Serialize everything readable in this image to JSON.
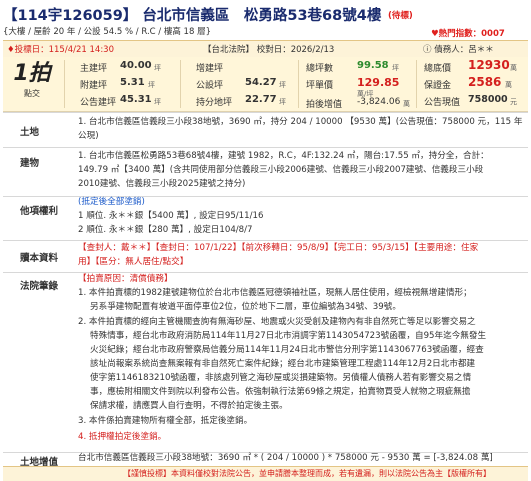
{
  "header": {
    "case_no": "【114宇126059】",
    "title": "台北市信義區　松勇路53巷68號4樓",
    "status": "(待標)",
    "heat_label": "♥熱門指數：0007",
    "subhead": "{大樓 / 屋齡 20 年 / 公設 54.5 % / R.C / 樓高 18 層}"
  },
  "bar": {
    "bid_date": "♦投標日：115/4/21 14:30",
    "court": "【台北法院】 校對日：2026/2/13",
    "debtor": "ⓘ 債務人：呂＊＊"
  },
  "summary": {
    "auction_no": "1拍",
    "auction_type": "點交",
    "main_area_k": "主建坪",
    "main_area_v": "40.00",
    "main_area_u": "坪",
    "attached_k": "附建坪",
    "attached_v": "5.31",
    "attached_u": "坪",
    "public_k": "公告建坪",
    "public_v": "45.31",
    "public_u": "坪",
    "added_k": "增建坪",
    "added_v": "",
    "common_k": "公設坪",
    "common_v": "54.27",
    "common_u": "坪",
    "land_share_k": "持分地坪",
    "land_share_v": "22.77",
    "land_share_u": "坪",
    "total_area_k": "總坪數",
    "total_area_v": "99.58",
    "total_area_u": "坪",
    "unit_price_k": "坪單價",
    "unit_price_v": "129.85",
    "unit_price_u": "萬/坪",
    "auction_vat_k": "拍後增值",
    "auction_vat_v": "-3,824.06",
    "auction_vat_u": "萬",
    "base_price_k": "總底價",
    "base_price_v": "12930",
    "base_price_u": "萬",
    "deposit_k": "保證金",
    "deposit_v": "2586",
    "deposit_u": "萬",
    "gov_price_k": "公告現值",
    "gov_price_v": "758000",
    "gov_price_u": "元"
  },
  "rows": {
    "land_label": "土地",
    "land_text": "1. 台北市信義區信義段三小段38地號，3690 ㎡，持分 204 / 10000 【9530 萬】(公告現值：758000 元，115 年公現)",
    "building_label": "建物",
    "building_text_1": "1. 台北市信義區松勇路53巷68號4樓，建號 1982，R.C，4F:132.24 ㎡，陽台:17.55 ㎡，持分全，合計：",
    "building_text_2": "149.79 ㎡【3400 萬】(含共同使用部分信義段三小段2006建號、信義段三小段2007建號、信義段三小段",
    "building_text_3": "2010建號、信義段三小段2025建號之持分)",
    "rights_label": "他項權利",
    "rights_title": "(抵定後全部塗銷)",
    "rights_1": "1 順位. 永＊＊銀【5400 萬】, 設定日95/11/16",
    "rights_2": "2 順位. 永＊＊銀【280 萬】, 設定日104/8/7",
    "lease_label": "贖本資料",
    "lease_text_1": "【查封人：戴＊＊】【查封日：107/1/22】【前次移轉日：95/8/9】【完工日：95/3/15】【主要用途：住家",
    "lease_text_2": "用】【區分：無人居住/點交】",
    "notes_label": "法院筆錄",
    "notes_title": "【拍賣原因：清償債務】",
    "note_1a": "1. 本件拍賣標的1982建號建物位於台北市信義區冠德領袖社區，現無人居住使用，經檢視無增建情形；",
    "note_1b": "另系爭建物配置有坡道平面停車位2位，位於地下二層，車位編號為34號、39號。",
    "note_2a": "2. 本件拍賣標的經向主管機關查詢有無海砂屋、地震或火災受創及建物內有非自然死亡等足以影響交易之",
    "note_2b": "特殊情事，經台北市政府消防局114年11月27日北市消調字第1143054723號函覆，自95年迄今無發生",
    "note_2c": "火災紀錄；經台北市政府警察局信義分局114年11月24日北市警信分刑字第1143067763號函覆，經查",
    "note_2d": "該址尚報案系統尚查無案報有非自然死亡案件紀錄；經台北市建築管理工程處114年12月2日北市都建",
    "note_2e": "使字第1146183210號函覆，非該處列管之海砂屋或災損建築物。另債權人債務人若有影響交易之情",
    "note_2f": "事，應檢附相關文件到院以利發布公告。依強制執行法第69條之規定，拍賣物買受人就物之瑕疵無擔",
    "note_2g": "保請求權，請應買人自行查明，不得於拍定後主張。",
    "note_3": "3. 本件係拍賣建物所有權全部，抵定後塗銷。",
    "note_4": "4. 抵押權拍定後塗銷。",
    "vat_label": "土地增值",
    "vat_text": "台北市信義區信義段三小段38地號：3690 ㎡ * ( 204 / 10000 ) * 758000 元 - 9530 萬 = [-3,824.08 萬]"
  },
  "disclaimer": "【謹慎投標】本資料僅校對法院公告，並申請謄本整理而成，若有遺漏，則以法院公告為主【版權所有】"
}
